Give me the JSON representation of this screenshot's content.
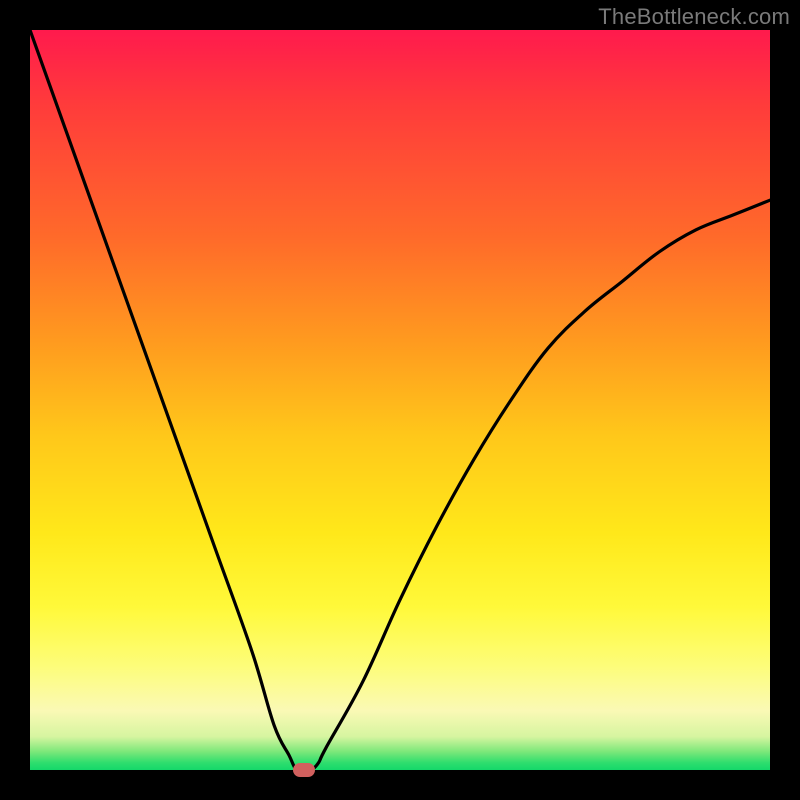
{
  "watermark": "TheBottleneck.com",
  "colors": {
    "frame": "#000000",
    "marker": "#d0605e",
    "curve": "#000000",
    "gradient_top": "#ff1a4d",
    "gradient_bottom": "#14d86a"
  },
  "chart_data": {
    "type": "line",
    "title": "",
    "xlabel": "",
    "ylabel": "",
    "xlim": [
      0,
      100
    ],
    "ylim": [
      0,
      100
    ],
    "grid": false,
    "series": [
      {
        "name": "bottleneck-curve",
        "x": [
          0,
          5,
          10,
          15,
          20,
          25,
          30,
          33,
          35,
          36,
          37,
          38,
          39,
          40,
          45,
          50,
          55,
          60,
          65,
          70,
          75,
          80,
          85,
          90,
          95,
          100
        ],
        "values": [
          100,
          86,
          72,
          58,
          44,
          30,
          16,
          6,
          2,
          0,
          0,
          0,
          1,
          3,
          12,
          23,
          33,
          42,
          50,
          57,
          62,
          66,
          70,
          73,
          75,
          77
        ]
      }
    ],
    "marker": {
      "x": 37,
      "y": 0
    },
    "legend": "none"
  }
}
